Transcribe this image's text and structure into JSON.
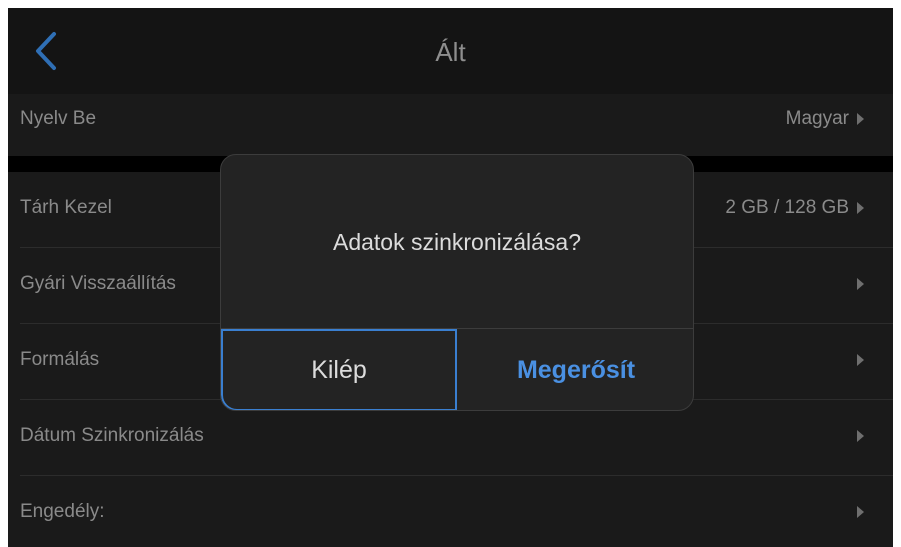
{
  "header": {
    "title": "Ált",
    "back_icon": "chevron-left-icon",
    "accent_color": "#2f6fb5"
  },
  "settings": {
    "language": {
      "label": "Nyelv Be",
      "value": "Magyar"
    },
    "storage": {
      "label": "Tárh Kezel",
      "value": "2 GB / 128 GB"
    },
    "factory_reset": {
      "label": "Gyári Visszaállítás"
    },
    "format": {
      "label": "Formálás"
    },
    "date_sync": {
      "label": "Dátum Szinkronizálás"
    },
    "permission": {
      "label": "Engedély:"
    }
  },
  "dialog": {
    "message": "Adatok szinkronizálása?",
    "exit_label": "Kilép",
    "confirm_label": "Megerősít",
    "confirm_color": "#4a90e2",
    "focus_color": "#3a7fd0"
  }
}
